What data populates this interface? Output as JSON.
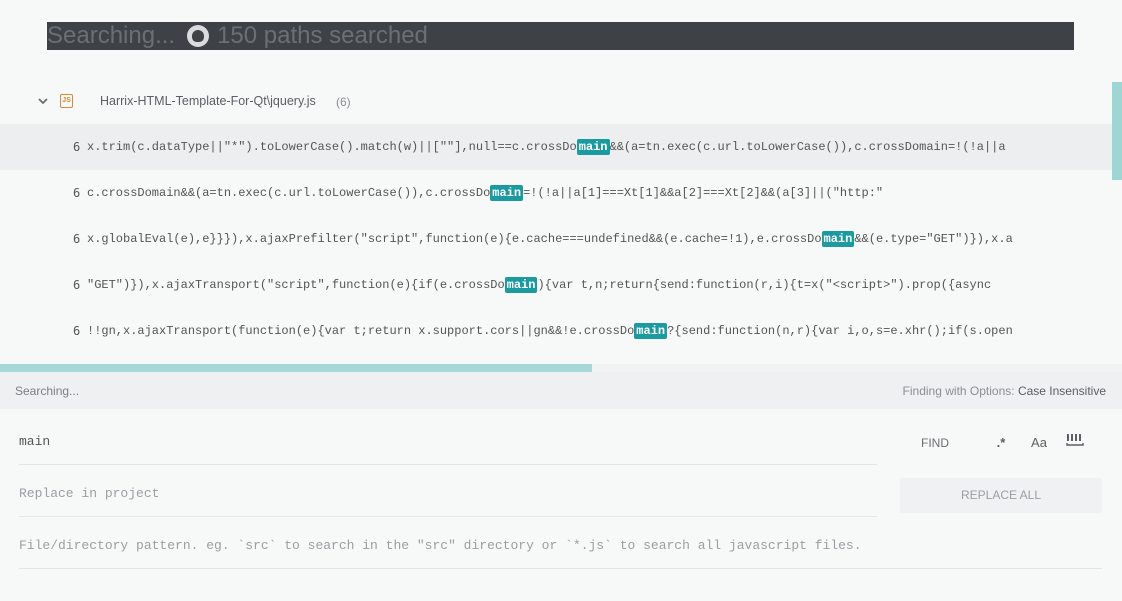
{
  "top_bar": {
    "searching_text": "Searching...",
    "icon": "github-icon",
    "paths_text": "150 paths searched"
  },
  "results": {
    "file": {
      "name": "Harrix-HTML-Template-For-Qt\\jquery.js",
      "count": "(6)",
      "icon_text": "JS"
    },
    "rows": [
      {
        "line": "6",
        "before": "x.trim(c.dataType||\"*\").toLowerCase().match(w)||[\"\"],null==c.crossDo",
        "match": "main",
        "after": "&&(a=tn.exec(c.url.toLowerCase()),c.crossDomain=!(!a||a"
      },
      {
        "line": "6",
        "before": "c.crossDomain&&(a=tn.exec(c.url.toLowerCase()),c.crossDo",
        "match": "main",
        "after": "=!(!a||a[1]===Xt[1]&&a[2]===Xt[2]&&(a[3]||(\"http:\""
      },
      {
        "line": "6",
        "before": "x.globalEval(e),e}}}),x.ajaxPrefilter(\"script\",function(e){e.cache===undefined&&(e.cache=!1),e.crossDo",
        "match": "main",
        "after": "&&(e.type=\"GET\")}),x.a"
      },
      {
        "line": "6",
        "before": "\"GET\")}),x.ajaxTransport(\"script\",function(e){if(e.crossDo",
        "match": "main",
        "after": "){var t,n;return{send:function(r,i){t=x(\"<script>\").prop({async"
      },
      {
        "line": "6",
        "before": "!!gn,x.ajaxTransport(function(e){var t;return x.support.cors||gn&&!e.crossDo",
        "match": "main",
        "after": "?{send:function(n,r){var i,o,s=e.xhr();if(s.open"
      }
    ]
  },
  "status": {
    "left": "Searching...",
    "right_prefix": "Finding with Options:",
    "right_option": "Case Insensitive"
  },
  "find": {
    "value": "main",
    "find_label": "FIND",
    "regex_icon": ".*",
    "case_icon": "Aa",
    "whole_word_icon": "whole-word-icon"
  },
  "replace": {
    "placeholder": "Replace in project",
    "button_label": "REPLACE ALL"
  },
  "pattern": {
    "placeholder": "File/directory pattern. eg. `src` to search in the \"src\" directory or `*.js` to search all javascript files."
  },
  "colors": {
    "accent": "#1b9aa0",
    "scrollbar": "#a6d8d7",
    "top_bar_bg": "#3e4247"
  }
}
